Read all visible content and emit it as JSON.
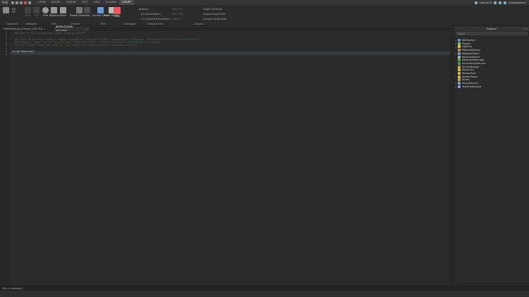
{
  "menubar": {
    "file_label": "FILE",
    "tabs": [
      "HOME",
      "MODEL",
      "AVATAR",
      "TEST",
      "VIEW",
      "PLUGINS",
      "SCRIPT"
    ],
    "user": "tommehit",
    "account": "Erikbegamer4"
  },
  "ribbon": {
    "buttons": {
      "paste": "",
      "back": "Back",
      "forward": "Fwd",
      "find": "Find",
      "replace": "Replace",
      "select": "Select",
      "format": "Format Selection",
      "play": "Play",
      "currentclient": "Current Client",
      "pause": "Pause Scripts",
      "stop": "Stop"
    },
    "groups": {
      "clipboard": "Clipboard",
      "navigate": "Navigate",
      "edit": "Edit",
      "format": "Format",
      "test": "Test",
      "debugger": "Debugger",
      "debug_errors": "Debug Errors",
      "actions": "Actions"
    },
    "options": {
      "never": "Never",
      "all_exceptions": "On All Exceptions",
      "unhandled": "On Unhandled Exceptions",
      "step_into": "Step Into",
      "step_over": "Step Over",
      "step_out": "Step Out",
      "toggle_comment": "Toggle Comment",
      "expand_folds": "Expand Script Folds",
      "collapse_folds": "Collapse Script Folds"
    }
  },
  "editor_tabs": [
    {
      "label": "• MainGame.gui [Console_2014 Fix]",
      "active": false
    },
    {
      "label": "INSTRUCTIONS [README]",
      "active": true
    }
  ],
  "editor": {
    "line_numbers": [
      "1",
      "2",
      "3",
      "4",
      "5",
      "6",
      "7",
      "8"
    ],
    "lines": [
      {
        "text": "--Welcome to the SimplePoint Studio loading system!",
        "kind": "comment"
      },
      {
        "text": "",
        "kind": "plain"
      },
      {
        "text": "--In order to use this product, simply ungroup the required folders (workspace to workspace, StarterCharacter to StarterCharacter)",
        "kind": "comment"
      },
      {
        "text": "--Note that in order for you to edit your \"ArmbG Position\" in StarterCharacter > StarterGui > PlayerGui",
        "kind": "comment"
      },
      {
        "text": "--For any \"chain\" model you wish to load inside the \"ChainFolder\" in workspace and EDIT!",
        "kind": "comment"
      },
      {
        "text": "",
        "kind": "plain"
      },
      {
        "text": "script:Destroy()",
        "kind": "plain"
      },
      {
        "text": "",
        "kind": "plain"
      }
    ]
  },
  "explorer": {
    "title": "Explorer",
    "search_placeholder": "Search",
    "items": [
      {
        "label": "Workspace",
        "color": "#5b9bd5",
        "expand": "▸"
      },
      {
        "label": "Players",
        "color": "#8fbf5a",
        "expand": "▸"
      },
      {
        "label": "Lighting",
        "color": "#e8c24a",
        "expand": "▸"
      },
      {
        "label": "MaterialService",
        "color": "#c98d4c",
        "expand": ""
      },
      {
        "label": "NetworkClient",
        "color": "#6aa0d6",
        "expand": "▸"
      },
      {
        "label": "ReplicatedFirst",
        "color": "#b0b0b0",
        "expand": ""
      },
      {
        "label": "ReplicatedStorage",
        "color": "#5aa35a",
        "expand": ""
      },
      {
        "label": "ServerScriptService",
        "color": "#4aa35a",
        "expand": ""
      },
      {
        "label": "ServerStorage",
        "color": "#d4a13a",
        "expand": ""
      },
      {
        "label": "StarterGui",
        "color": "#d6b84a",
        "expand": ""
      },
      {
        "label": "StarterPack",
        "color": "#d6b84a",
        "expand": ""
      },
      {
        "label": "StarterPlayer",
        "color": "#d6b84a",
        "expand": "▸"
      },
      {
        "label": "Teams",
        "color": "#c9a54a",
        "expand": ""
      },
      {
        "label": "SoundService",
        "color": "#7aa6d6",
        "expand": "▸"
      },
      {
        "label": "TextChatService",
        "color": "#7aa6d6",
        "expand": "▸"
      }
    ]
  },
  "command_bar": {
    "placeholder": "Run a command"
  }
}
